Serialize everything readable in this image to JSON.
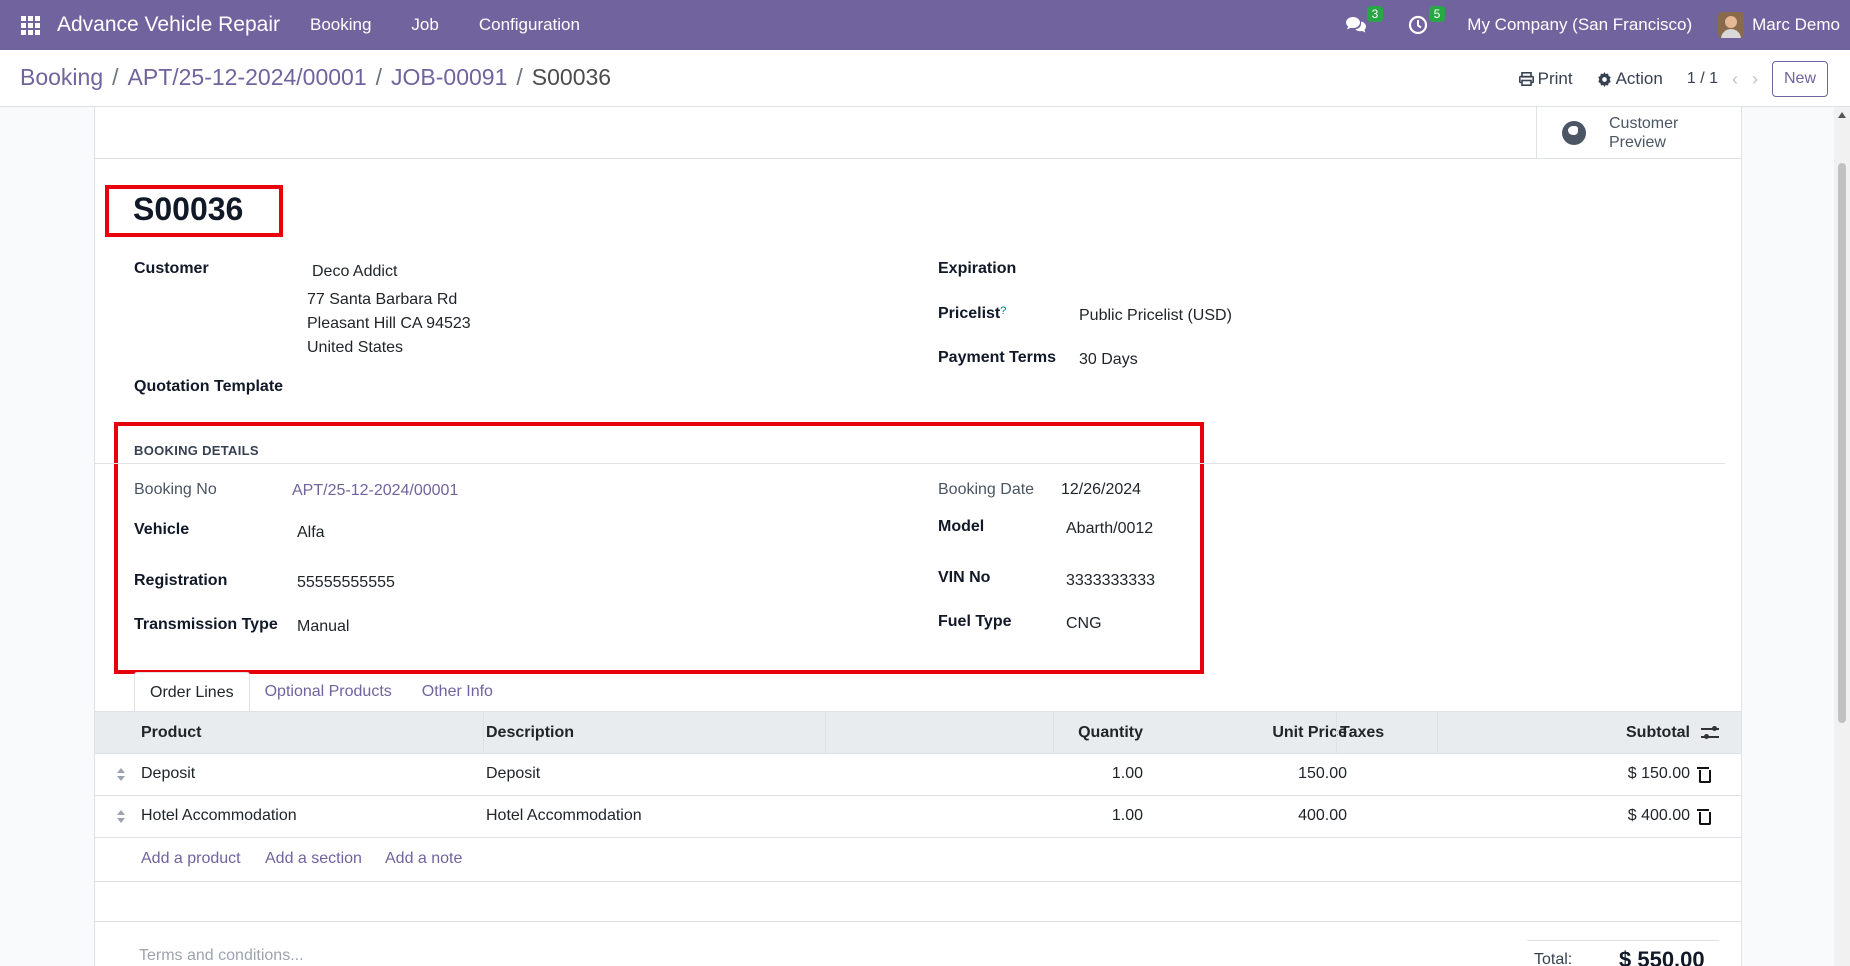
{
  "navbar": {
    "app_name": "Advance Vehicle Repair",
    "menus": [
      "Booking",
      "Job",
      "Configuration"
    ],
    "messages_count": "3",
    "activities_count": "5",
    "company": "My Company (San Francisco)",
    "user": "Marc Demo"
  },
  "breadcrumb": {
    "items": [
      "Booking",
      "APT/25-12-2024/00001",
      "JOB-00091"
    ],
    "current": "S00036",
    "sep": "/"
  },
  "control": {
    "print_label": "Print",
    "action_label": "Action",
    "pager": "1 / 1",
    "new_label": "New"
  },
  "smart_button": {
    "label": "Customer Preview"
  },
  "record": {
    "name": "S00036",
    "customer_label": "Customer",
    "customer": "Deco Addict",
    "address": [
      "77 Santa Barbara Rd",
      "Pleasant Hill CA 94523",
      "United States"
    ],
    "quotation_template_label": "Quotation Template",
    "expiration_label": "Expiration",
    "pricelist_label": "Pricelist",
    "pricelist_help": "?",
    "pricelist": "Public Pricelist (USD)",
    "payment_terms_label": "Payment Terms",
    "payment_terms": "30 Days"
  },
  "booking": {
    "section_title": "BOOKING DETAILS",
    "booking_no_label": "Booking No",
    "booking_no": "APT/25-12-2024/00001",
    "booking_date_label": "Booking Date",
    "booking_date": "12/26/2024",
    "vehicle_label": "Vehicle",
    "vehicle": "Alfa",
    "model_label": "Model",
    "model": "Abarth/0012",
    "registration_label": "Registration",
    "registration": "55555555555",
    "vin_label": "VIN No",
    "vin": "3333333333",
    "transmission_label": "Transmission Type",
    "transmission": "Manual",
    "fuel_label": "Fuel Type",
    "fuel": "CNG"
  },
  "tabs": [
    "Order Lines",
    "Optional Products",
    "Other Info"
  ],
  "order_lines": {
    "columns": {
      "product": "Product",
      "description": "Description",
      "quantity": "Quantity",
      "unit_price": "Unit Price",
      "taxes": "Taxes",
      "subtotal": "Subtotal"
    },
    "rows": [
      {
        "product": "Deposit",
        "description": "Deposit",
        "quantity": "1.00",
        "unit_price": "150.00",
        "taxes": "",
        "subtotal": "$ 150.00"
      },
      {
        "product": "Hotel Accommodation",
        "description": "Hotel Accommodation",
        "quantity": "1.00",
        "unit_price": "400.00",
        "taxes": "",
        "subtotal": "$ 400.00"
      }
    ],
    "add_product": "Add a product",
    "add_section": "Add a section",
    "add_note": "Add a note"
  },
  "footer": {
    "terms_placeholder": "Terms and conditions...",
    "total_label": "Total:",
    "total_value": "$ 550.00"
  }
}
